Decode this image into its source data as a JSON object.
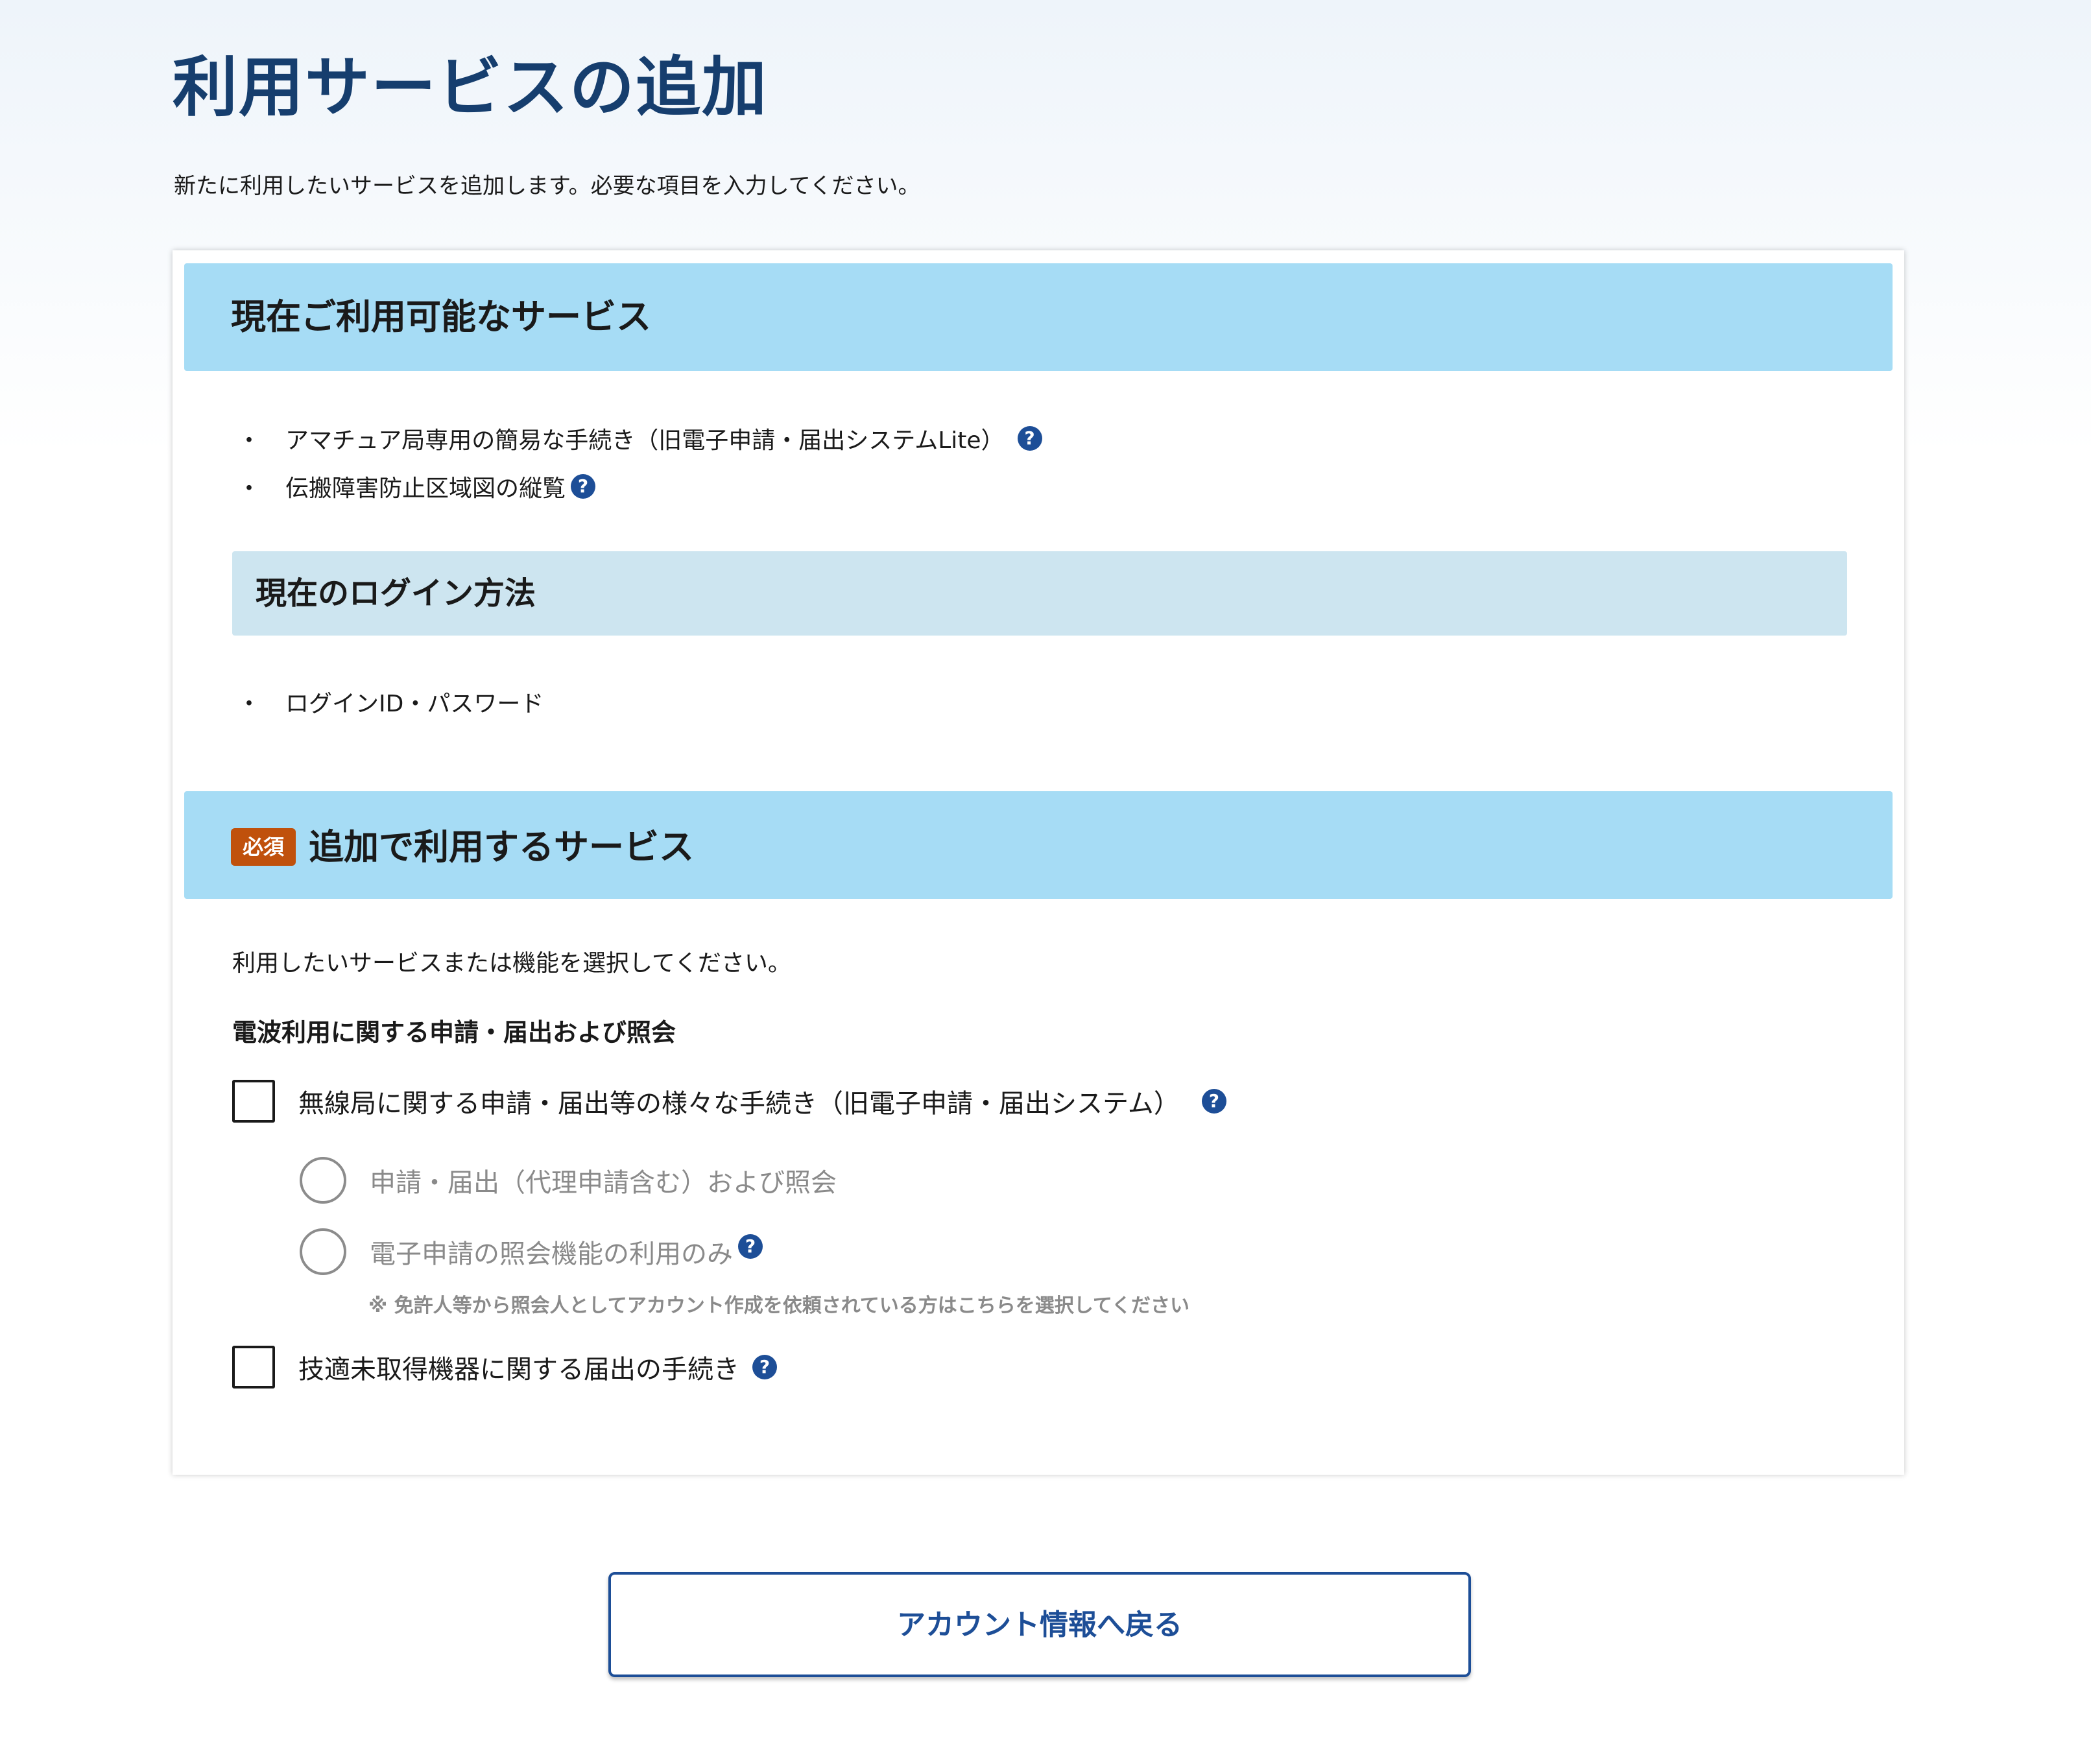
{
  "page": {
    "title": "利用サービスの追加",
    "description": "新たに利用したいサービスを追加します。必要な項目を入力してください。"
  },
  "current_services": {
    "title": "現在ご利用可能なサービス",
    "items": [
      {
        "label": "アマチュア局専用の簡易な手続き（旧電子申請・届出システムLite）",
        "has_help": true
      },
      {
        "label": "伝搬障害防止区域図の縦覧",
        "has_help": true
      }
    ]
  },
  "login_method": {
    "title": "現在のログイン方法",
    "items": [
      "ログインID・パスワード"
    ]
  },
  "add_services": {
    "required_badge": "必須",
    "title": "追加で利用するサービス",
    "instruction": "利用したいサービスまたは機能を選択してください。",
    "group_title": "電波利用に関する申請・届出および照会",
    "option_wireless": {
      "label": "無線局に関する申請・届出等の様々な手続き（旧電子申請・届出システム）",
      "checked": false,
      "suboptions": [
        {
          "label": "申請・届出（代理申請含む）および照会",
          "selected": false
        },
        {
          "label": "電子申請の照会機能の利用のみ",
          "selected": false
        }
      ],
      "note": "※ 免許人等から照会人としてアカウント作成を依頼されている方はこちらを選択してください"
    },
    "option_device": {
      "label": "技適未取得機器に関する届出の手続き",
      "checked": false
    }
  },
  "help_icon_glyph": "?",
  "bullet_glyph": "・",
  "back_button": {
    "label": "アカウント情報へ戻る"
  },
  "colors": {
    "title": "#163e6e",
    "band": "#a6dcf5",
    "subband": "#cde5f0",
    "accent": "#1d4e97",
    "required": "#c0510c",
    "disabled_text": "#8a8a8a"
  },
  "icons": {
    "help": "question-circle-icon",
    "checkbox": "checkbox-icon",
    "radio": "radio-icon"
  }
}
